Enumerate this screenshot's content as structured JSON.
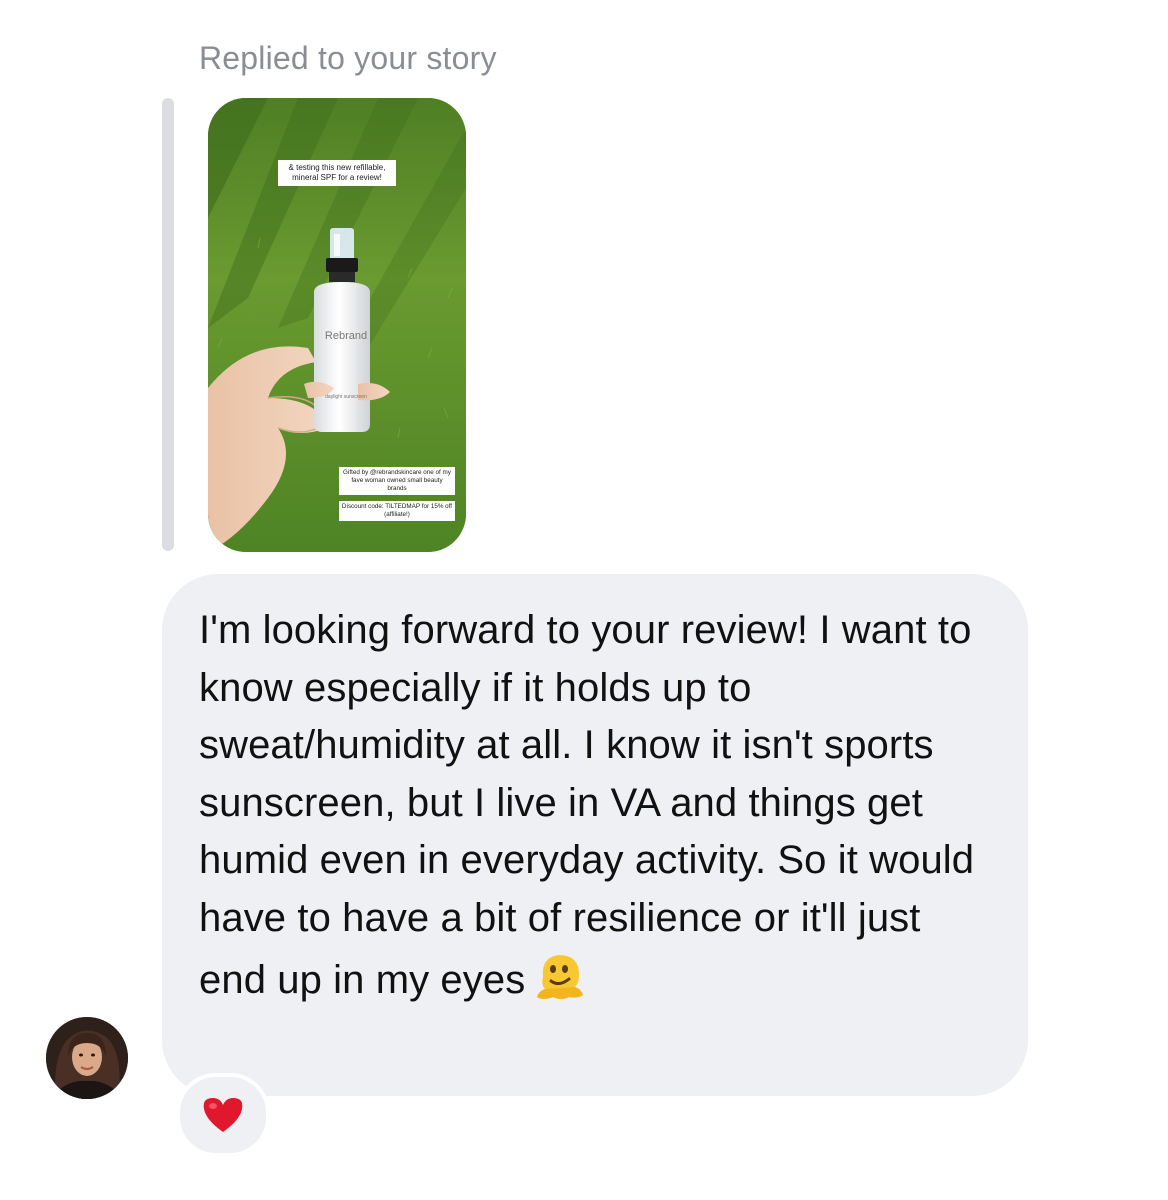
{
  "reply": {
    "label": "Replied to your story"
  },
  "story": {
    "caption": "& testing this new refillable, mineral SPF for a review!",
    "bottle_brand": "Rebrand",
    "bottle_sub": "daylight sunscreen",
    "gift_note": "Gifted by @rebrandskincare one of my fave woman owned small beauty brands",
    "discount_note": "Discount code: TILTEDMAP for 15% off (affiliate!)"
  },
  "message": {
    "text": "I'm looking forward to your review! I want to know especially if it holds up to sweat/humidity at all. I know it isn't sports sunscreen, but I live in VA and things get humid even in everyday activity. So it would have to have a bit of resilience or it'll just end up in my eyes",
    "emoji": "melting-face-emoji"
  },
  "reaction": {
    "emoji": "❤️"
  },
  "colors": {
    "bubble": "#eff0f4",
    "label": "#8a8d93",
    "reply_bar": "#dcdde1"
  }
}
